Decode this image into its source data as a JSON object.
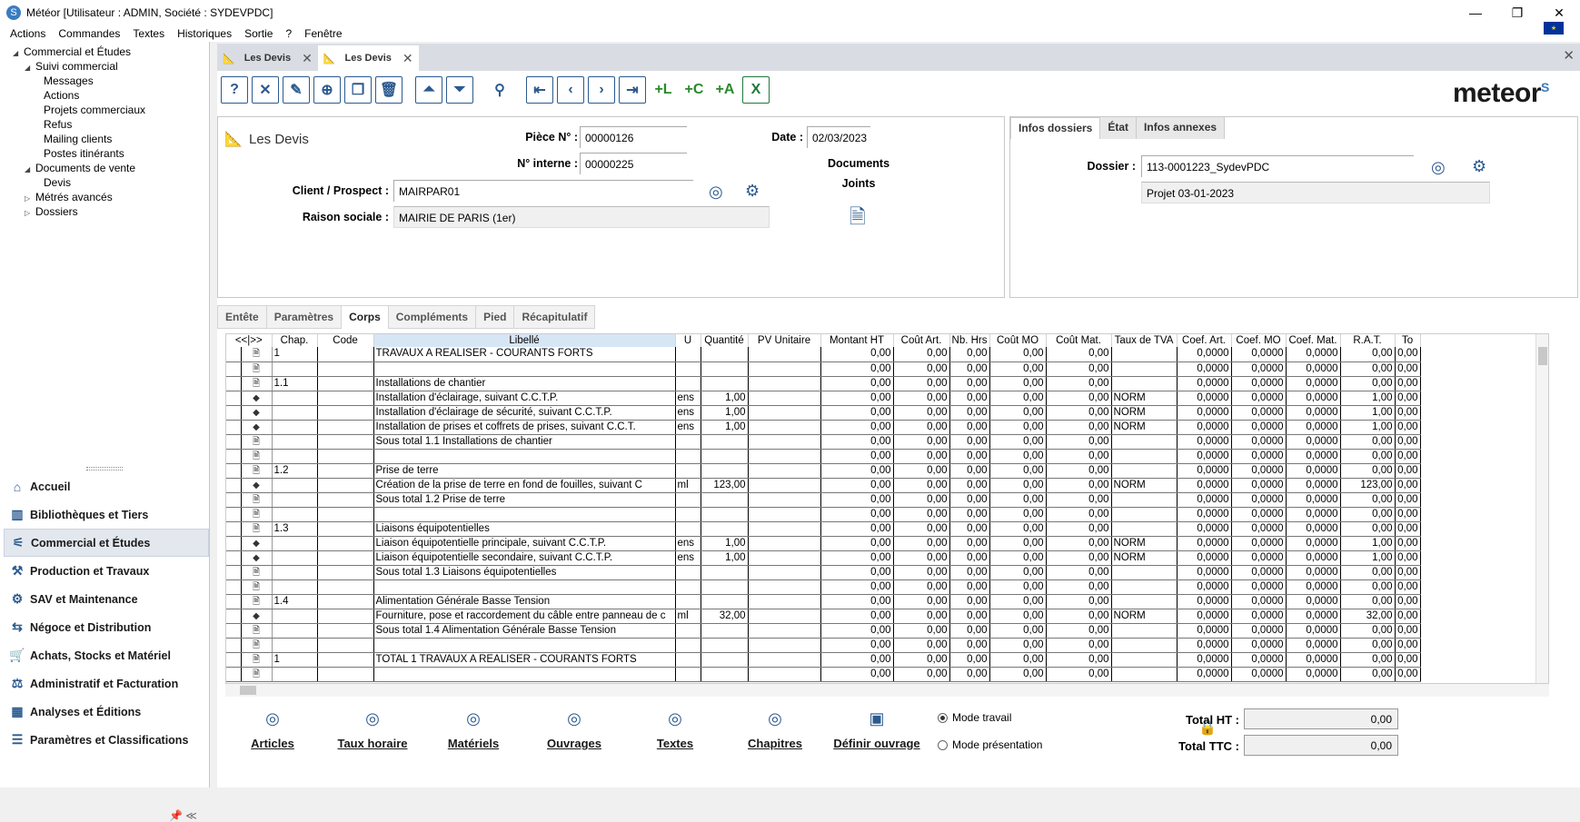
{
  "window": {
    "title": "Météor [Utilisateur : ADMIN, Société : SYDEVPDC]",
    "app_icon": "meteor-app-icon",
    "controls": [
      "minimize",
      "maximize",
      "close"
    ]
  },
  "menu": [
    "Actions",
    "Commandes",
    "Textes",
    "Historiques",
    "Sortie",
    "?",
    "Fenêtre"
  ],
  "tree": [
    {
      "label": "Commercial et Études",
      "level": 0,
      "expander": "◢"
    },
    {
      "label": "Suivi commercial",
      "level": 1,
      "expander": "◢"
    },
    {
      "label": "Messages",
      "level": 2,
      "expander": ""
    },
    {
      "label": "Actions",
      "level": 2,
      "expander": ""
    },
    {
      "label": "Projets commerciaux",
      "level": 2,
      "expander": ""
    },
    {
      "label": "Refus",
      "level": 2,
      "expander": ""
    },
    {
      "label": "Mailing clients",
      "level": 2,
      "expander": ""
    },
    {
      "label": "Postes itinérants",
      "level": 2,
      "expander": ""
    },
    {
      "label": "Documents de vente",
      "level": 1,
      "expander": "◢"
    },
    {
      "label": "Devis",
      "level": 2,
      "expander": ""
    },
    {
      "label": "Métrés avancés",
      "level": 1,
      "expander": "▷"
    },
    {
      "label": "Dossiers",
      "level": 1,
      "expander": "▷"
    }
  ],
  "nav": [
    {
      "label": "Accueil",
      "icon": "home-icon",
      "active": false
    },
    {
      "label": "Bibliothèques et Tiers",
      "icon": "library-icon",
      "active": false
    },
    {
      "label": "Commercial et Études",
      "icon": "compass-icon",
      "active": true
    },
    {
      "label": "Production et Travaux",
      "icon": "worker-icon",
      "active": false
    },
    {
      "label": "SAV et Maintenance",
      "icon": "maintenance-icon",
      "active": false
    },
    {
      "label": "Négoce et Distribution",
      "icon": "trade-icon",
      "active": false
    },
    {
      "label": "Achats, Stocks et Matériel",
      "icon": "cart-icon",
      "active": false
    },
    {
      "label": "Administratif et Facturation",
      "icon": "admin-icon",
      "active": false
    },
    {
      "label": "Analyses et Éditions",
      "icon": "chart-icon",
      "active": false
    },
    {
      "label": "Paramètres et Classifications",
      "icon": "settings-icon",
      "active": false
    }
  ],
  "doc_tabs": [
    {
      "label": "Les Devis",
      "active": false
    },
    {
      "label": "Les Devis",
      "active": true
    }
  ],
  "logo": "meteor",
  "header": {
    "title": "Les Devis",
    "piece_label": "Pièce N° :",
    "piece_value": "00000126",
    "interne_label": "N° interne :",
    "interne_value": "00000225",
    "date_label": "Date :",
    "date_value": "02/03/2023",
    "client_label": "Client / Prospect :",
    "client_value": "MAIRPAR01",
    "raison_label": "Raison sociale :",
    "raison_value": "MAIRIE DE PARIS (1er)",
    "docs_label1": "Documents",
    "docs_label2": "Joints"
  },
  "dossier": {
    "tabs": [
      {
        "label": "Infos dossiers",
        "active": true
      },
      {
        "label": "État",
        "active": false
      },
      {
        "label": "Infos annexes",
        "active": false
      }
    ],
    "label": "Dossier :",
    "value": "113-0001223_SydevPDC",
    "project": "Projet 03-01-2023"
  },
  "subtabs": [
    {
      "label": "Entête",
      "active": false
    },
    {
      "label": "Paramètres",
      "active": false
    },
    {
      "label": "Corps",
      "active": true
    },
    {
      "label": "Compléments",
      "active": false
    },
    {
      "label": "Pied",
      "active": false
    },
    {
      "label": "Récapitulatif",
      "active": false
    }
  ],
  "grid": {
    "nav_label": "<<|>>",
    "columns": [
      "Chap.",
      "Code",
      "Libellé",
      "U",
      "Quantité",
      "PV Unitaire",
      "Montant HT",
      "Coût Art.",
      "Nb. Hrs",
      "Coût MO",
      "Coût Mat.",
      "Taux de TVA",
      "Coef. Art.",
      "Coef. MO",
      "Coef. Mat.",
      "R.A.T.",
      "To"
    ],
    "rows": [
      {
        "type": "doc",
        "chap": "1",
        "lib": "TRAVAUX A REALISER - COURANTS FORTS",
        "u": "",
        "q": "",
        "tva": "",
        "rat": "0,00"
      },
      {
        "type": "doc",
        "chap": "",
        "lib": "",
        "u": "",
        "q": "",
        "tva": "",
        "rat": "0,00"
      },
      {
        "type": "doc",
        "chap": "1.1",
        "lib": "Installations de chantier",
        "u": "",
        "q": "",
        "tva": "",
        "rat": "0,00"
      },
      {
        "type": "art",
        "chap": "",
        "lib": "Installation d'éclairage, suivant C.C.T.P.",
        "u": "ens",
        "q": "1,00",
        "tva": "NORM",
        "rat": "1,00"
      },
      {
        "type": "art",
        "chap": "",
        "lib": "Installation d'éclairage de sécurité, suivant C.C.T.P.",
        "u": "ens",
        "q": "1,00",
        "tva": "NORM",
        "rat": "1,00"
      },
      {
        "type": "art",
        "chap": "",
        "lib": "Installation de prises et coffrets de prises, suivant C.C.T.",
        "u": "ens",
        "q": "1,00",
        "tva": "NORM",
        "rat": "1,00"
      },
      {
        "type": "doc",
        "chap": "",
        "lib": "Sous total 1.1 Installations de chantier",
        "u": "",
        "q": "",
        "tva": "",
        "rat": "0,00"
      },
      {
        "type": "doc",
        "chap": "",
        "lib": "",
        "u": "",
        "q": "",
        "tva": "",
        "rat": "0,00"
      },
      {
        "type": "doc",
        "chap": "1.2",
        "lib": "Prise de terre",
        "u": "",
        "q": "",
        "tva": "",
        "rat": "0,00"
      },
      {
        "type": "art",
        "chap": "",
        "lib": "Création de la prise de terre en fond de fouilles, suivant C",
        "u": "ml",
        "q": "123,00",
        "tva": "NORM",
        "rat": "123,00"
      },
      {
        "type": "doc",
        "chap": "",
        "lib": "Sous total 1.2 Prise de terre",
        "u": "",
        "q": "",
        "tva": "",
        "rat": "0,00"
      },
      {
        "type": "doc",
        "chap": "",
        "lib": "",
        "u": "",
        "q": "",
        "tva": "",
        "rat": "0,00"
      },
      {
        "type": "doc",
        "chap": "1.3",
        "lib": "Liaisons équipotentielles",
        "u": "",
        "q": "",
        "tva": "",
        "rat": "0,00"
      },
      {
        "type": "art",
        "chap": "",
        "lib": "Liaison équipotentielle principale, suivant C.C.T.P.",
        "u": "ens",
        "q": "1,00",
        "tva": "NORM",
        "rat": "1,00"
      },
      {
        "type": "art",
        "chap": "",
        "lib": "Liaison équipotentielle secondaire, suivant C.C.T.P.",
        "u": "ens",
        "q": "1,00",
        "tva": "NORM",
        "rat": "1,00"
      },
      {
        "type": "doc",
        "chap": "",
        "lib": "Sous total 1.3 Liaisons équipotentielles",
        "u": "",
        "q": "",
        "tva": "",
        "rat": "0,00"
      },
      {
        "type": "doc",
        "chap": "",
        "lib": "",
        "u": "",
        "q": "",
        "tva": "",
        "rat": "0,00"
      },
      {
        "type": "doc",
        "chap": "1.4",
        "lib": "Alimentation Générale Basse Tension",
        "u": "",
        "q": "",
        "tva": "",
        "rat": "0,00"
      },
      {
        "type": "art",
        "chap": "",
        "lib": "Fourniture, pose et raccordement du câble entre panneau de c",
        "u": "ml",
        "q": "32,00",
        "tva": "NORM",
        "rat": "32,00"
      },
      {
        "type": "doc",
        "chap": "",
        "lib": "Sous total 1.4 Alimentation Générale Basse Tension",
        "u": "",
        "q": "",
        "tva": "",
        "rat": "0,00"
      },
      {
        "type": "doc",
        "chap": "",
        "lib": "",
        "u": "",
        "q": "",
        "tva": "",
        "rat": "0,00"
      },
      {
        "type": "doc",
        "chap": "1",
        "lib": "TOTAL 1 TRAVAUX A REALISER - COURANTS FORTS",
        "u": "",
        "q": "",
        "tva": "",
        "rat": "0,00"
      },
      {
        "type": "doc",
        "chap": "",
        "lib": "",
        "u": "",
        "q": "",
        "tva": "",
        "rat": "0,00"
      }
    ],
    "zero2": "0,00",
    "zero4": "0,0000"
  },
  "bottom_actions": [
    "Articles",
    "Taux horaire",
    "Matériels",
    "Ouvrages",
    "Textes",
    "Chapitres",
    "Définir ouvrage"
  ],
  "mode": {
    "travail": "Mode travail",
    "presentation": "Mode présentation",
    "selected": "travail"
  },
  "totals": {
    "ht_label": "Total HT :",
    "ht_value": "0,00",
    "ttc_label": "Total TTC :",
    "ttc_value": "0,00"
  }
}
